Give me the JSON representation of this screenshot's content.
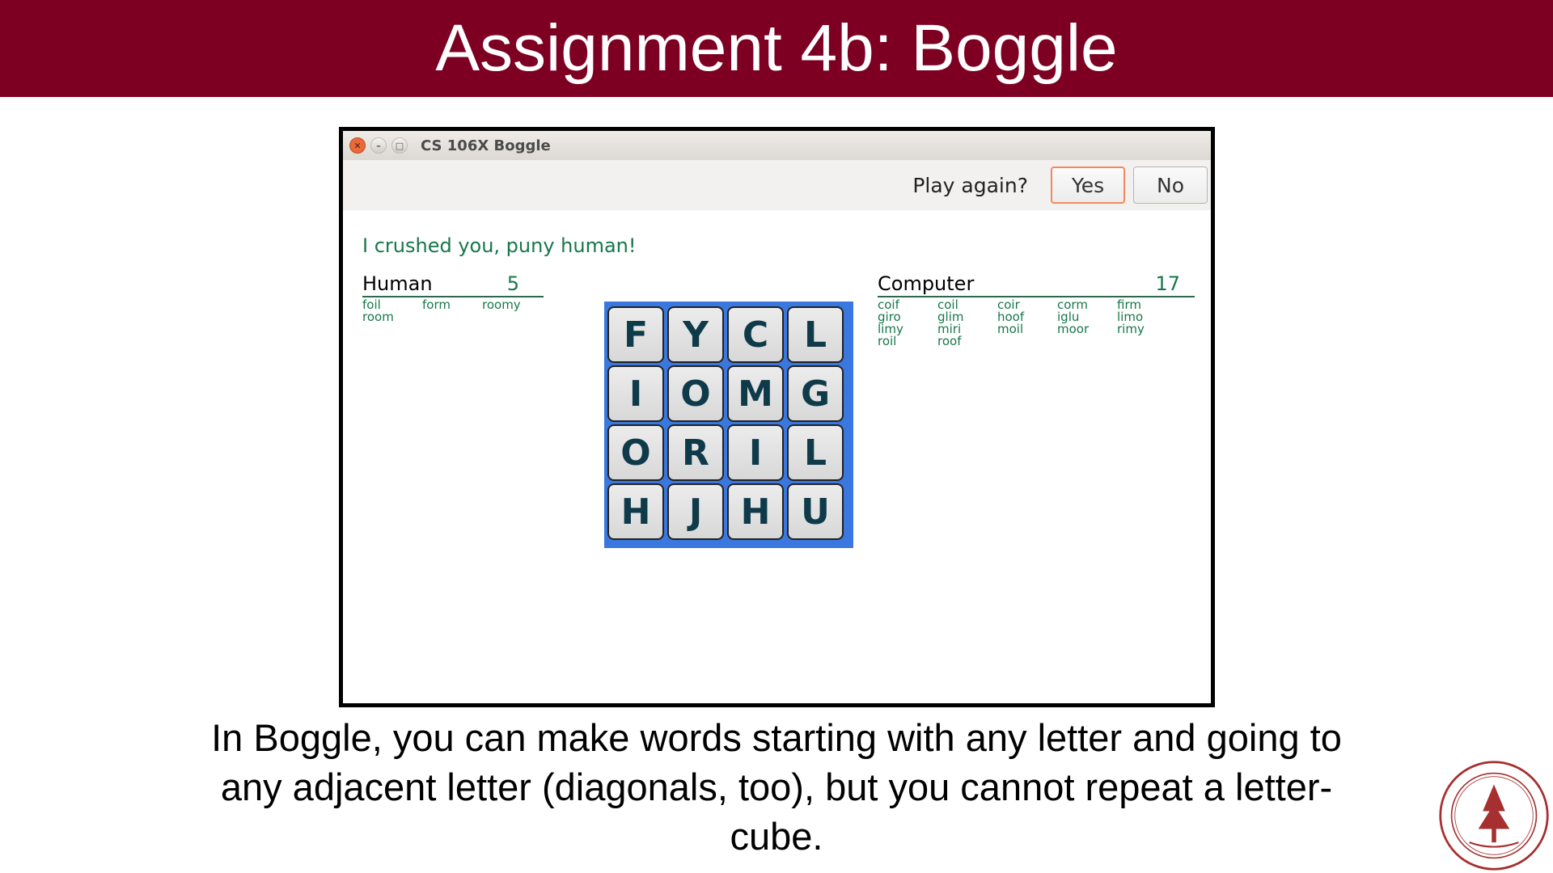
{
  "slide": {
    "title": "Assignment 4b: Boggle",
    "caption": "In Boggle, you can make words starting with any letter and going to any adjacent letter (diagonals, too), but you cannot repeat a letter-cube."
  },
  "window": {
    "title": "CS 106X Boggle",
    "close_icon": "close-icon",
    "minimize_icon": "minimize-icon",
    "maximize_icon": "maximize-icon"
  },
  "toolbar": {
    "prompt": "Play again?",
    "yes_label": "Yes",
    "no_label": "No"
  },
  "message": "I crushed you, puny human!",
  "human": {
    "name": "Human",
    "score": "5",
    "words": [
      "foil",
      "form",
      "roomy",
      "room"
    ]
  },
  "computer": {
    "name": "Computer",
    "score": "17",
    "words": [
      "coif",
      "coil",
      "coir",
      "corm",
      "firm",
      "giro",
      "glim",
      "hoof",
      "iglu",
      "limo",
      "limy",
      "miri",
      "moil",
      "moor",
      "rimy",
      "roil",
      "roof"
    ]
  },
  "board": {
    "letters": [
      "F",
      "Y",
      "C",
      "L",
      "I",
      "O",
      "M",
      "G",
      "O",
      "R",
      "I",
      "L",
      "H",
      "J",
      "H",
      "U"
    ]
  },
  "colors": {
    "header": "#7d0023",
    "accent": "#16774a",
    "board": "#3a78e0"
  }
}
